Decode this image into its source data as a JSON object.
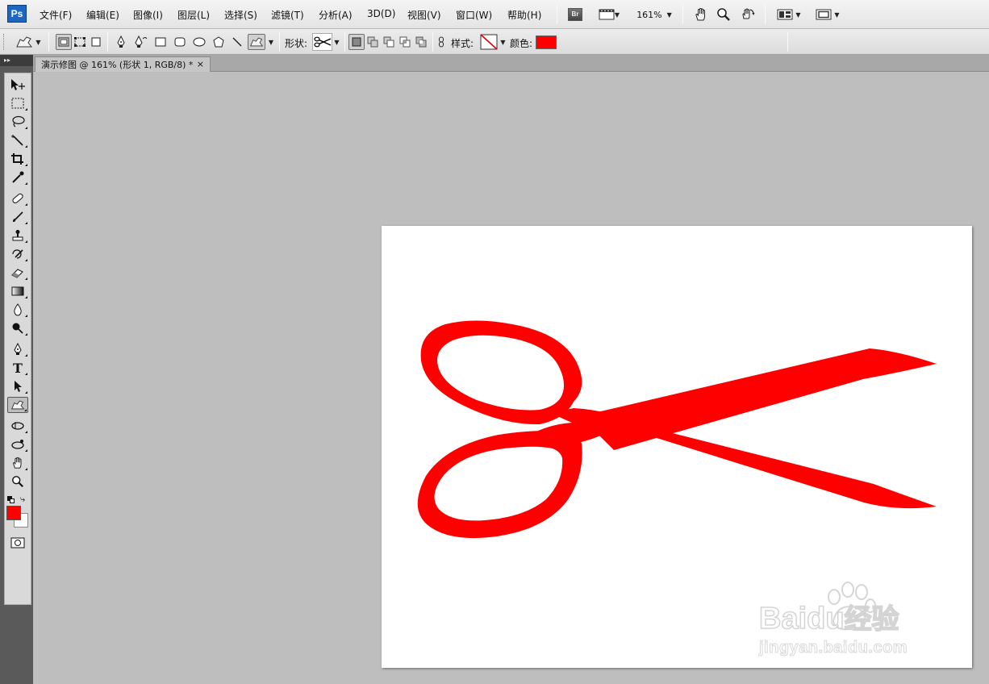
{
  "app": {
    "logo": "Ps"
  },
  "menu": [
    {
      "label": "文件(F)"
    },
    {
      "label": "编辑(E)"
    },
    {
      "label": "图像(I)"
    },
    {
      "label": "图层(L)"
    },
    {
      "label": "选择(S)"
    },
    {
      "label": "滤镜(T)"
    },
    {
      "label": "分析(A)"
    },
    {
      "label": "3D(D)"
    },
    {
      "label": "视图(V)"
    },
    {
      "label": "窗口(W)"
    },
    {
      "label": "帮助(H)"
    }
  ],
  "toolbar": {
    "bridge_label": "Br",
    "zoom_value": "161%",
    "icons": [
      "bridge-icon",
      "film-icon",
      "hand-icon",
      "zoom-icon",
      "rotate-icon",
      "arrange-icon",
      "screen-mode-icon"
    ]
  },
  "options": {
    "shape_label": "形状:",
    "style_label": "样式:",
    "color_label": "颜色:",
    "color_value": "#ff0000",
    "shape_preset": "scissors-icon"
  },
  "document": {
    "tab_title": "演示修图 @ 161% (形状 1, RGB/8) *",
    "close_glyph": "×",
    "shape_color": "#ff0000"
  },
  "tools": [
    "move-tool",
    "marquee-tool",
    "lasso-tool",
    "magic-wand-tool",
    "crop-tool",
    "eyedropper-tool",
    "healing-brush-tool",
    "brush-tool",
    "clone-stamp-tool",
    "history-brush-tool",
    "eraser-tool",
    "gradient-tool",
    "blur-tool",
    "dodge-tool",
    "pen-tool",
    "type-tool",
    "path-selection-tool",
    "custom-shape-tool",
    "3d-rotate-tool",
    "3d-orbit-tool",
    "hand-tool",
    "zoom-tool"
  ],
  "colors": {
    "foreground": "#ff0000",
    "background": "#ffffff"
  },
  "watermark": {
    "brand": "Baidu",
    "suffix": "经验",
    "url": "jingyan.baidu.com"
  }
}
